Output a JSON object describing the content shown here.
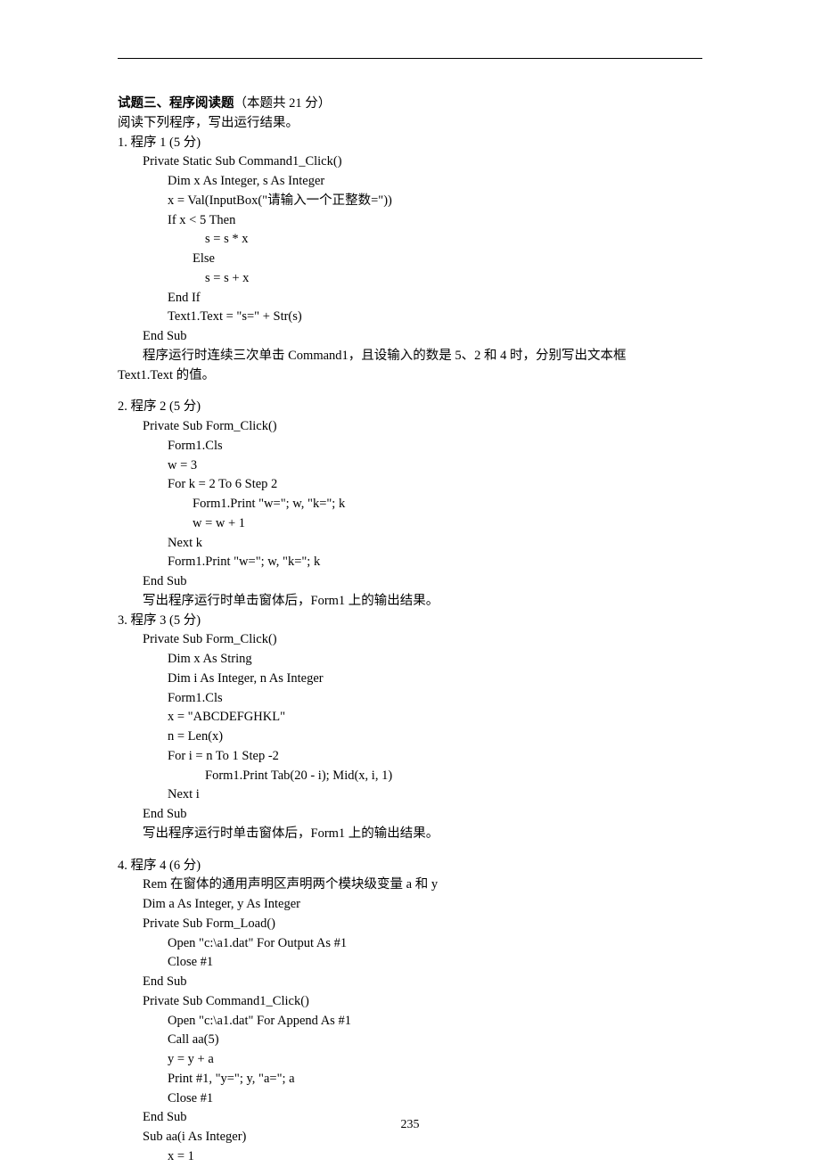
{
  "header": {
    "section_title_bold": "试题三、程序阅读题",
    "section_title_rest": "（本题共 21 分）",
    "instruction": "阅读下列程序，写出运行结果。"
  },
  "q1": {
    "title": "1.  程序 1 (5 分)",
    "l1": "Private Static Sub Command1_Click()",
    "l2": "Dim x As Integer, s As Integer",
    "l3": "x = Val(InputBox(\"请输入一个正整数=\"))",
    "l4": "If x < 5 Then",
    "l5": "s = s * x",
    "l6": "Else",
    "l7": "s = s + x",
    "l8": "End If",
    "l9": "Text1.Text = \"s=\" + Str(s)",
    "l10": "End Sub",
    "prompt_a": "程序运行时连续三次单击 Command1，且设输入的数是 5、2 和 4 时，分别写出文本框",
    "prompt_b": "Text1.Text 的值。"
  },
  "q2": {
    "title": "2.  程序 2 (5 分)",
    "l1": "Private Sub Form_Click()",
    "l2": "Form1.Cls",
    "l3": "w = 3",
    "l4": "For k = 2 To 6 Step 2",
    "l5": "Form1.Print \"w=\"; w, \"k=\"; k",
    "l6": "w = w + 1",
    "l7": "Next k",
    "l8": "Form1.Print \"w=\"; w, \"k=\"; k",
    "l9": "End Sub",
    "prompt": "写出程序运行时单击窗体后，Form1 上的输出结果。"
  },
  "q3": {
    "title": "3.  程序 3 (5 分)",
    "l1": "Private Sub Form_Click()",
    "l2": "Dim x As String",
    "l3": "Dim i As Integer, n As Integer",
    "l4": "Form1.Cls",
    "l5": "x = \"ABCDEFGHKL\"",
    "l6": "n = Len(x)",
    "l7": "For i = n To 1 Step -2",
    "l8": "Form1.Print Tab(20 - i); Mid(x, i, 1)",
    "l9": "Next i",
    "l10": "End Sub",
    "prompt": "写出程序运行时单击窗体后，Form1 上的输出结果。"
  },
  "q4": {
    "title": "4.  程序 4 (6 分)",
    "l1": "Rem  在窗体的通用声明区声明两个模块级变量 a 和 y",
    "l2": "Dim a As Integer, y As Integer",
    "l3": "Private Sub Form_Load()",
    "l4": "Open \"c:\\a1.dat\" For Output As #1",
    "l5": "Close #1",
    "l6": "End Sub",
    "l7": "Private Sub Command1_Click()",
    "l8": "Open \"c:\\a1.dat\" For Append As #1",
    "l9": "Call aa(5)",
    "l10": "y = y + a",
    "l11": "Print #1, \"y=\"; y, \"a=\"; a",
    "l12": "Close #1",
    "l13": "End Sub",
    "l14": "Sub aa(i As Integer)",
    "l15": "x = 1"
  },
  "page_number": "235"
}
